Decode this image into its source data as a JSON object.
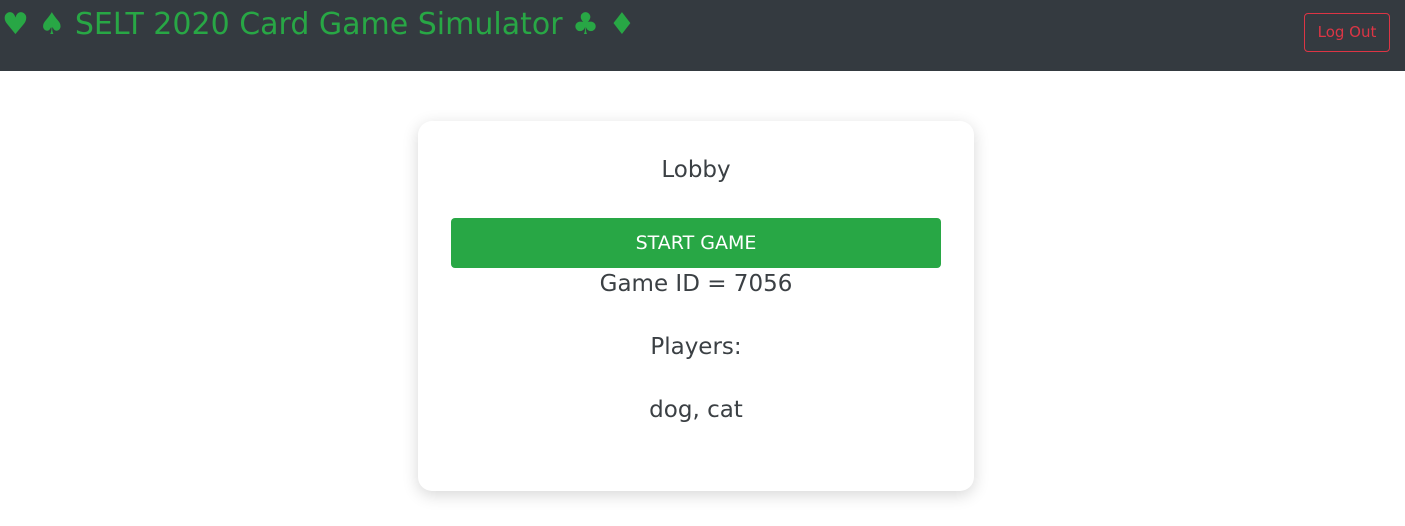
{
  "header": {
    "brand": "♥ ♠ SELT 2020 Card Game Simulator ♣ ♦",
    "logout_label": "Log Out"
  },
  "lobby": {
    "title": "Lobby",
    "start_label": "START GAME",
    "game_id_text": "Game ID = 7056",
    "players_label": "Players:",
    "players_list": "dog, cat"
  },
  "colors": {
    "navbar": "#343a40",
    "brand": "#28a745",
    "logout": "#dc3545",
    "start_button": "#28a745"
  }
}
